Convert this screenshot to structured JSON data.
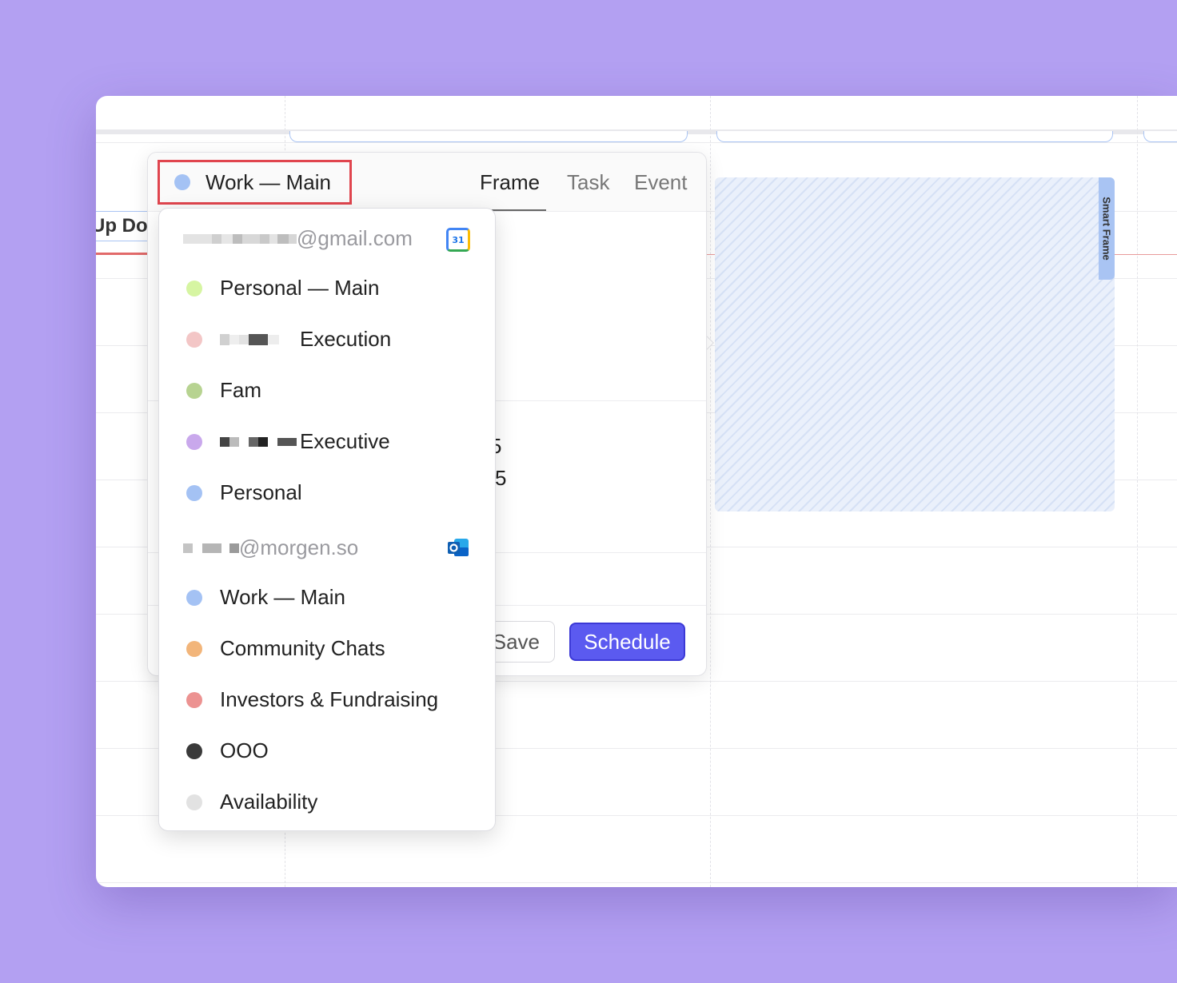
{
  "calendar_view": {
    "event_left_text": "Up Do",
    "smart_frame_label": "Smart Frame"
  },
  "popover": {
    "selected_calendar": {
      "label": "Work — Main",
      "color": "#a4c2f4"
    },
    "tabs": [
      {
        "label": "Frame",
        "active": true
      },
      {
        "label": "Task",
        "active": false
      },
      {
        "label": "Event",
        "active": false
      }
    ],
    "fragments": [
      ")",
      "5",
      "5"
    ],
    "save_label": "Save",
    "schedule_label": "Schedule"
  },
  "dropdown": {
    "accounts": [
      {
        "email_suffix": "@gmail.com",
        "icon": "google-calendar-icon",
        "icon_text": "31",
        "calendars": [
          {
            "label": "Personal — Main",
            "color": "#d6f5a2"
          },
          {
            "label": "Execution",
            "color": "#f3c6c6"
          },
          {
            "label": "Fam",
            "color": "#b7d391"
          },
          {
            "label": "Executive",
            "color": "#c9a8ec"
          },
          {
            "label": "Personal",
            "color": "#a4c2f4"
          }
        ]
      },
      {
        "email_suffix": "@morgen.so",
        "icon": "outlook-icon",
        "calendars": [
          {
            "label": "Work — Main",
            "color": "#a4c2f4"
          },
          {
            "label": "Community Chats",
            "color": "#f2b57a"
          },
          {
            "label": "Investors & Fundraising",
            "color": "#ec9291"
          },
          {
            "label": "OOO",
            "color": "#3a3a3a"
          },
          {
            "label": "Availability",
            "color": "#e2e2e2"
          }
        ]
      }
    ]
  },
  "colors": {
    "background": "#b3a0f2",
    "accent": "#5b5af0",
    "highlight_border": "#e0454e"
  }
}
